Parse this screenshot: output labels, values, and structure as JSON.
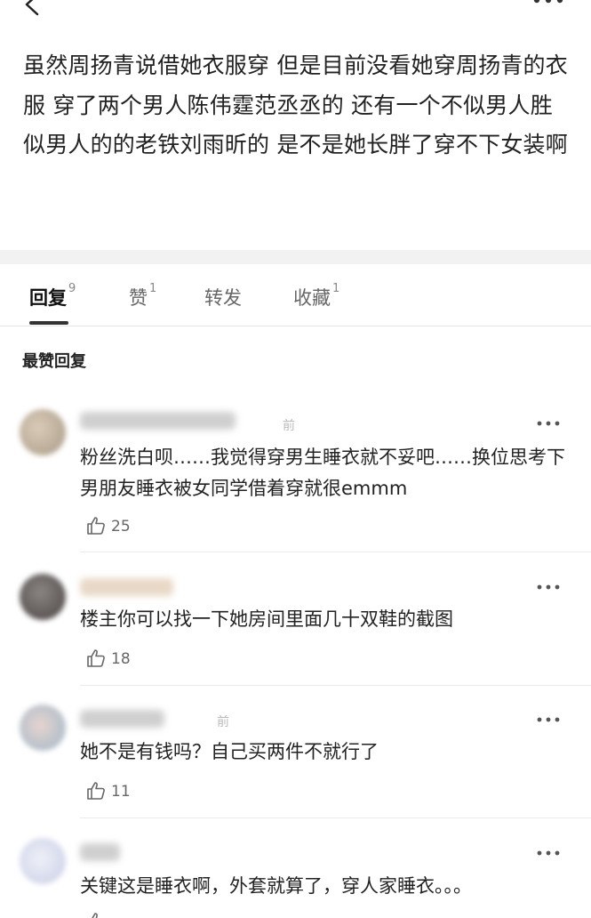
{
  "post": {
    "text": "虽然周扬青说借她衣服穿 但是目前没看她穿周扬青的衣服 穿了两个男人陈伟霆范丞丞的 还有一个不似男人胜似男人的的老铁刘雨昕的  是不是她长胖了穿不下女装啊"
  },
  "tabs": [
    {
      "label": "回复",
      "count": "9"
    },
    {
      "label": "赞",
      "count": "1"
    },
    {
      "label": "转发",
      "count": ""
    },
    {
      "label": "收藏",
      "count": "1"
    }
  ],
  "section_title": "最赞回复",
  "comments": [
    {
      "time": "前",
      "text": "粉丝洗白呗……我觉得穿男生睡衣就不妥吧……换位思考下男朋友睡衣被女同学借着穿就很emmm",
      "likes": "25"
    },
    {
      "time": "",
      "text": "楼主你可以找一下她房间里面几十双鞋的截图",
      "likes": "18"
    },
    {
      "time": "前",
      "text": "她不是有钱吗？自己买两件不就行了",
      "likes": "11"
    },
    {
      "time": "",
      "text": "关键这是睡衣啊，外套就算了，穿人家睡衣。。。",
      "likes": ""
    }
  ],
  "colors": {
    "accent": "#333333",
    "muted": "#666666",
    "gap": "#f2f2f2"
  }
}
